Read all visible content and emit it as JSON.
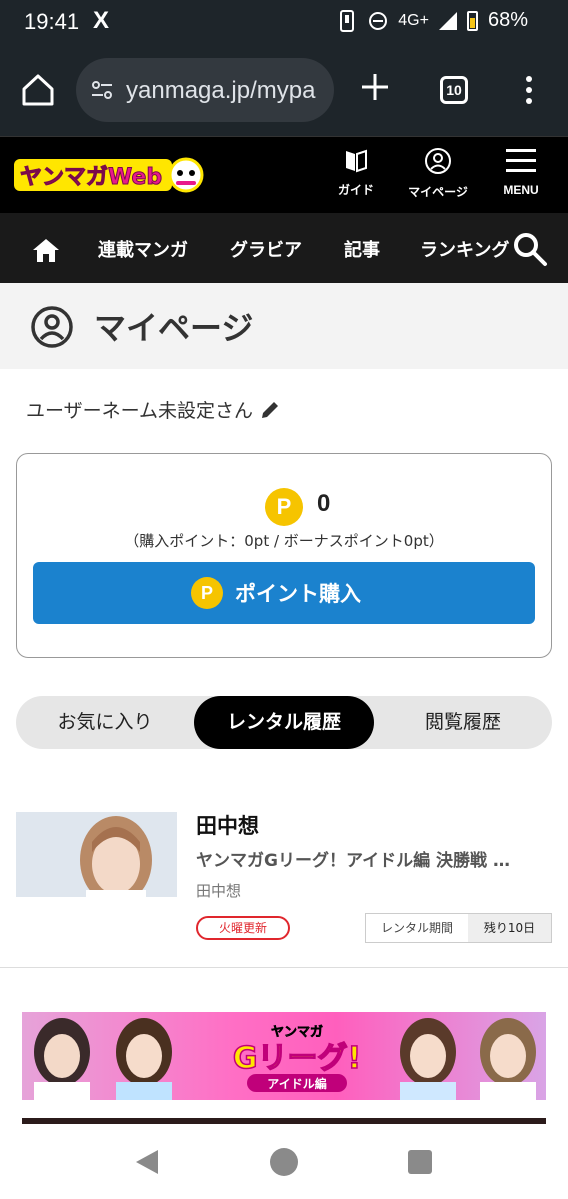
{
  "status_bar": {
    "time": "19:41",
    "x_icon": "X",
    "network": "4G+",
    "battery": "68%"
  },
  "browser": {
    "url": "yanmaga.jp/mypa",
    "tab_count": "10"
  },
  "header": {
    "logo_text": "ヤンマガWeb",
    "guide_label": "ガイド",
    "mypage_label": "マイページ",
    "menu_label": "MENU"
  },
  "nav": {
    "items": [
      "連載マンガ",
      "グラビア",
      "記事",
      "ランキング"
    ]
  },
  "page": {
    "title": "マイページ",
    "username": "ユーザーネーム未設定さん"
  },
  "points": {
    "p_symbol": "P",
    "total": "0",
    "breakdown": "（購入ポイント：0pt / ボーナスポイント0pt）",
    "buy_label": "ポイント購入"
  },
  "tabs": {
    "favorites": "お気に入り",
    "rental": "レンタル履歴",
    "history": "閲覧履歴"
  },
  "rental_item": {
    "title": "田中想",
    "subtitle": "ヤンマガGリーグ！アイドル編 決勝戦 …",
    "author": "田中想",
    "update_badge": "火曜更新",
    "period_label": "レンタル期間",
    "remaining": "残り10日"
  },
  "banner": {
    "logo_top": "ヤンマガ",
    "logo_main": "Gリーグ!",
    "logo_sub": "アイドル編"
  },
  "colors": {
    "accent_blue": "#1b82ce",
    "point_yellow": "#f6c400",
    "update_red": "#e0262d"
  }
}
